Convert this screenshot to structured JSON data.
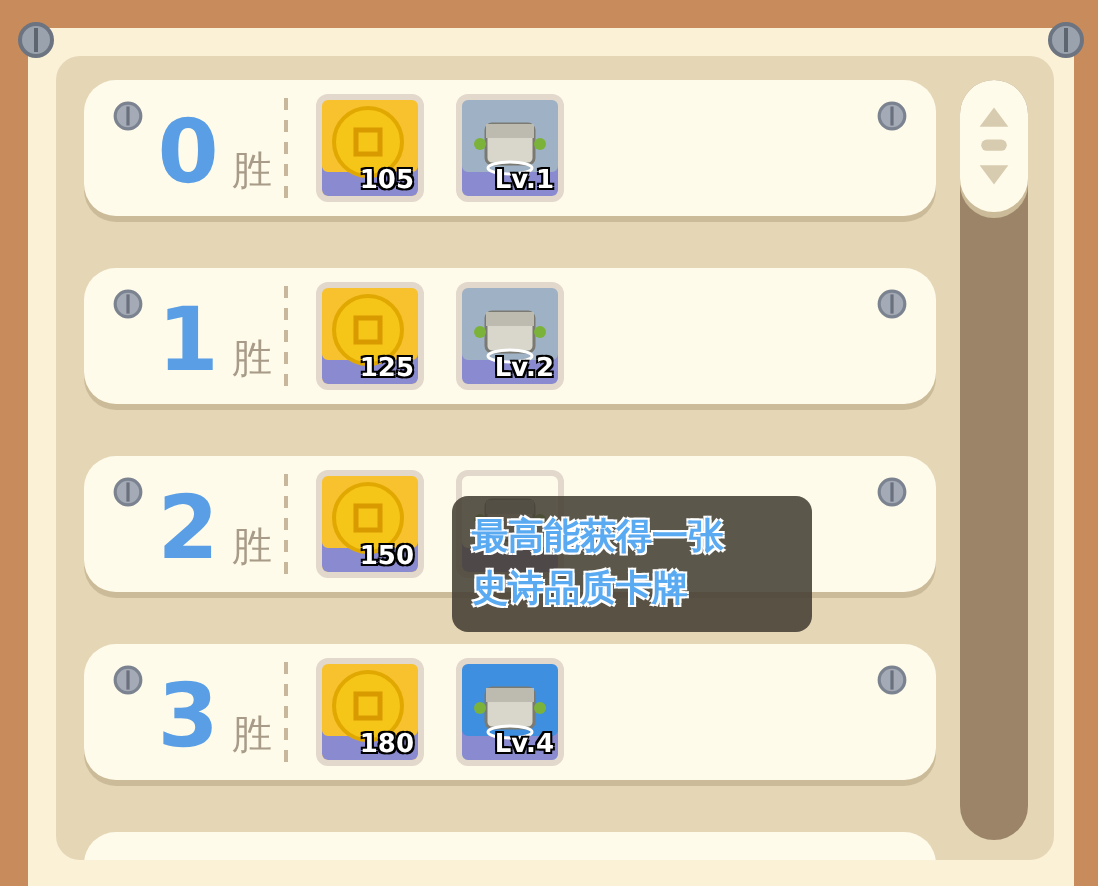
{
  "rows": [
    {
      "wins": "0",
      "unit": "胜",
      "rewards": [
        {
          "kind": "coin",
          "label": "105"
        },
        {
          "kind": "chest",
          "label": "Lv.1",
          "color": "#9fb1c4"
        }
      ]
    },
    {
      "wins": "1",
      "unit": "胜",
      "rewards": [
        {
          "kind": "coin",
          "label": "125"
        },
        {
          "kind": "chest",
          "label": "Lv.2",
          "color": "#9fb1c4"
        }
      ]
    },
    {
      "wins": "2",
      "unit": "胜",
      "rewards": [
        {
          "kind": "coin",
          "label": "150"
        },
        {
          "kind": "chest"
        }
      ]
    },
    {
      "wins": "3",
      "unit": "胜",
      "rewards": [
        {
          "kind": "coin",
          "label": "180"
        },
        {
          "kind": "chest",
          "label": "Lv.4",
          "color": "#3f8fe0"
        }
      ]
    }
  ],
  "tooltip": {
    "lines": [
      "最高能获得一张",
      "史诗品质卡牌"
    ]
  }
}
